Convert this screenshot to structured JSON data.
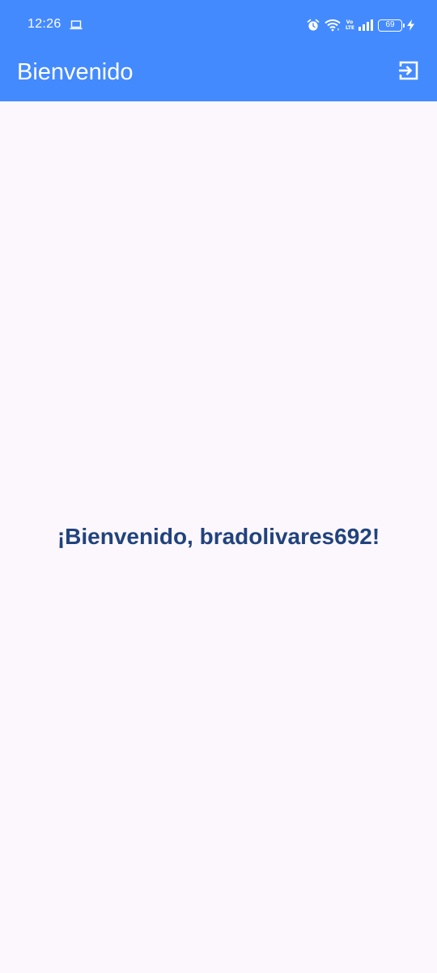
{
  "status_bar": {
    "time": "12:26",
    "battery_level": "69",
    "network_label": "Vo LTE",
    "icons": [
      "laptop-icon",
      "alarm-icon",
      "wifi-icon",
      "volte-icon",
      "signal-icon",
      "battery-icon",
      "charging-icon"
    ]
  },
  "toolbar": {
    "title": "Bienvenido",
    "logout_icon": "logout-icon"
  },
  "main": {
    "welcome_message": "¡Bienvenido, bradolivares692!"
  },
  "colors": {
    "app_bar": "#448aff",
    "background": "#fcf7fd",
    "welcome_text": "#21437d"
  }
}
